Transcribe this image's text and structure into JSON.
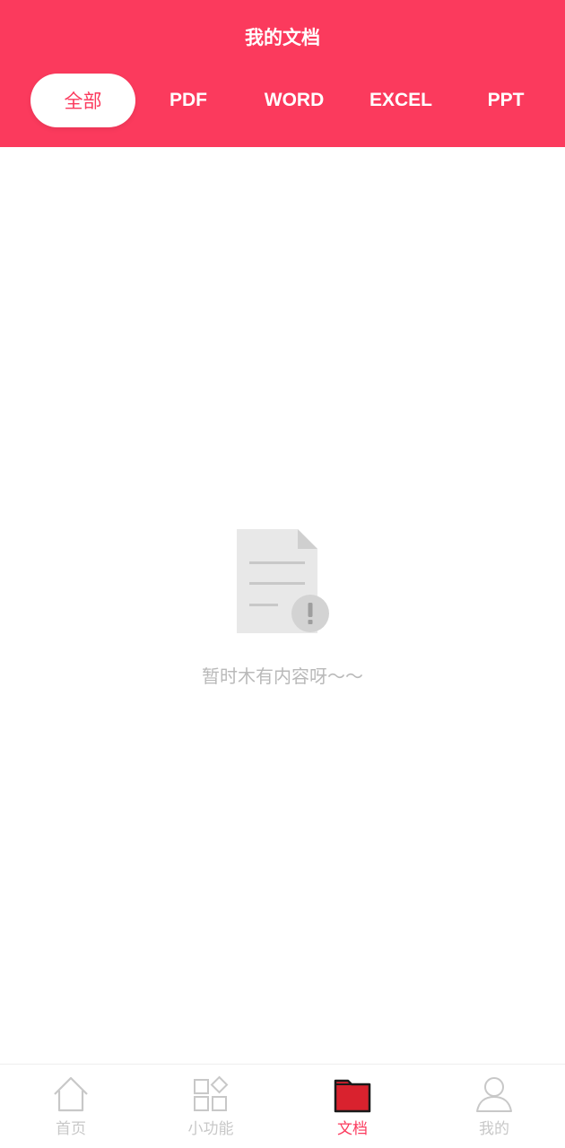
{
  "header": {
    "title": "我的文档",
    "tabs": [
      {
        "label": "全部",
        "active": true
      },
      {
        "label": "PDF",
        "active": false
      },
      {
        "label": "WORD",
        "active": false
      },
      {
        "label": "EXCEL",
        "active": false
      },
      {
        "label": "PPT",
        "active": false
      }
    ]
  },
  "empty_state": {
    "icon": "document-warning-icon",
    "message": "暂时木有内容呀～～"
  },
  "bottom_nav": {
    "items": [
      {
        "label": "首页",
        "icon": "home-icon",
        "active": false
      },
      {
        "label": "小功能",
        "icon": "widgets-icon",
        "active": false
      },
      {
        "label": "文档",
        "icon": "folder-icon",
        "active": true
      },
      {
        "label": "我的",
        "icon": "user-icon",
        "active": false
      }
    ]
  },
  "colors": {
    "accent": "#fb3a5d",
    "inactive": "#c8c8c8",
    "folder_fill": "#d9222e"
  }
}
